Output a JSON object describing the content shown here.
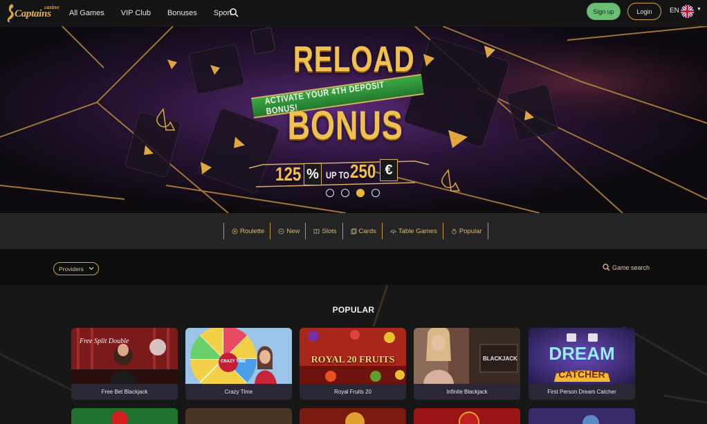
{
  "header": {
    "logo_small": "casino",
    "logo_main": "Captains",
    "nav": [
      "All Games",
      "VIP Club",
      "Bonuses",
      "Sport"
    ],
    "signup_label": "Sign up",
    "login_label": "Login",
    "language": "EN"
  },
  "banner": {
    "headline_top": "RELOAD",
    "ribbon": "ACTIVATE YOUR 4TH DEPOSIT BONUS!",
    "headline_bottom": "BONUS",
    "offer_percent_value": "125",
    "offer_percent_symbol": "%",
    "offer_upto": "UP TO",
    "offer_amount": "250",
    "offer_currency": "€",
    "slides_total": 4,
    "active_slide": 3
  },
  "categories": [
    {
      "label": "Roulette",
      "icon": "roulette-icon"
    },
    {
      "label": "New",
      "icon": "new-icon"
    },
    {
      "label": "Slots",
      "icon": "slots-icon"
    },
    {
      "label": "Cards",
      "icon": "cards-icon"
    },
    {
      "label": "Table Games",
      "icon": "table-games-icon"
    },
    {
      "label": "Popular",
      "icon": "popular-icon"
    }
  ],
  "filter": {
    "providers_label": "Providers",
    "search_label": "Game search"
  },
  "section": {
    "title": "POPULAR"
  },
  "games": [
    {
      "title": "Free Bet Blackjack",
      "thumb_text": "Free Split Double"
    },
    {
      "title": "Crazy Time",
      "thumb_text": "CRAZY TIME"
    },
    {
      "title": "Royal Fruits 20",
      "thumb_text": "ROYAL 20 FRUITS"
    },
    {
      "title": "Infinite Blackjack",
      "thumb_text": "BLACKJACK"
    },
    {
      "title": "First Person Dream Catcher",
      "thumb_text_top": "DREAM",
      "thumb_text_bottom": "CATCHER"
    }
  ],
  "colors": {
    "accent_gold": "#d9a441",
    "signup_green": "#6bbf74",
    "dot_active": "#e8b73a"
  }
}
